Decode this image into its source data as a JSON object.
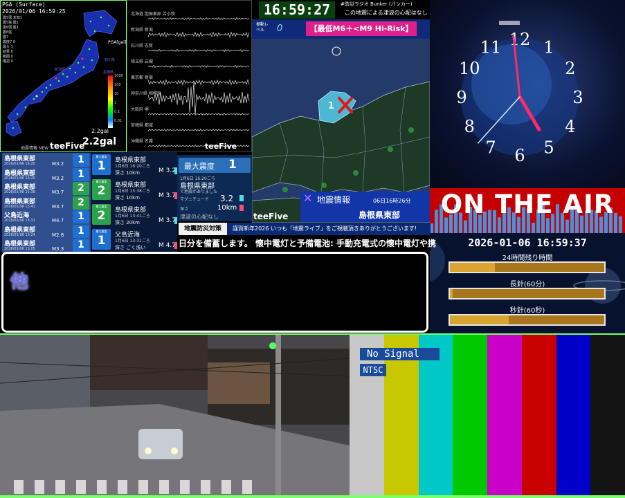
{
  "pga_panel": {
    "title": "PGA (Surface)",
    "timestamp": "2026/01/06 16:59:25",
    "stats": [
      "震5弱  未知1",
      "震5強  震1",
      "震6弱  震1",
      "震6強  ",
      "震7  ",
      "震度7 0",
      "最大 1",
      "結果 8",
      "範囲 0",
      "確認 0"
    ],
    "unit_label": "PGA[gal]",
    "scale_ticks": [
      "1000",
      "100",
      "10",
      "1",
      "0.1",
      "0.01"
    ],
    "small_value": "2.2gal",
    "big_value": "2.2gal",
    "map_labels": [
      "新潟県",
      "石川県",
      "島根県"
    ]
  },
  "waveform_panel": {
    "stations": [
      "北海道 胆振東部 苫小牧",
      "新潟県 新潟",
      "石川県 志賀",
      "埼玉県 岩槻",
      "東京都 新宿",
      "神奈川県 相模原",
      "大阪府 堺",
      "宮崎県 都城",
      "沖縄県 名護"
    ],
    "brand": "teeFive"
  },
  "quake_list": {
    "header": "地震情報 NEW",
    "brand": "teeFive",
    "rows": [
      {
        "name": "島根県東部",
        "date": "2026/01/06 16:20",
        "mag": "M3.2",
        "shindo": "1"
      },
      {
        "name": "島根県東部",
        "date": "2026/01/06 16:20",
        "mag": "M3.2",
        "shindo": "1"
      },
      {
        "name": "島根県東部",
        "date": "2026/01/06 15:38",
        "mag": "M3.7",
        "shindo": "2"
      },
      {
        "name": "島根県東部",
        "date": "2026/01/06 13:41",
        "mag": "M3.7",
        "shindo": "2"
      },
      {
        "name": "父島近海",
        "date": "2026/01/06 13:31",
        "mag": "M4.7",
        "shindo": "1"
      },
      {
        "name": "島根県東部",
        "date": "2026/01/06 13:24",
        "mag": "M2.8",
        "shindo": "1"
      },
      {
        "name": "島根県東部",
        "date": "2026/01/06 13:05",
        "mag": "M3.3",
        "shindo": "1"
      }
    ]
  },
  "quake_detail": [
    {
      "box_label": "最大震度",
      "shindo": "1",
      "place": "島根県東部",
      "time": "1月6日 16:20ごろ",
      "depth": "深さ 10km",
      "mag": "M 3.2"
    },
    {
      "box_label": "最大震度",
      "shindo": "2",
      "place": "島根県東部",
      "time": "1月6日 15:38ごろ",
      "depth": "深さ 10km",
      "mag": "M 3.7"
    },
    {
      "box_label": "最大震度",
      "shindo": "2",
      "place": "島根県東部",
      "time": "1月6日 13:41ごろ",
      "depth": "深さ 20km",
      "mag": "M 3.7"
    },
    {
      "box_label": "最大震度",
      "shindo": "1",
      "place": "父島近海",
      "time": "1月6日 13:31ごろ",
      "depth": "深さ ごく浅い",
      "mag": "M 4.7"
    }
  ],
  "max_intensity": {
    "label": "最大震度",
    "value": "1",
    "time": "1月6日 16:20ごろ",
    "place": "島根県東部",
    "note": "で地震がありました",
    "mag_label": "マグニチュード",
    "mag_value": "3.2",
    "depth_label": "深さ",
    "depth_value": "10km",
    "tsunami": "津波の心配なし"
  },
  "top_bar": {
    "time": "16:59:27",
    "bunker": "#防災ラジオ Bunker (バンカー)",
    "tsunami_note": "この地震による津波の心配はなし",
    "level_label": "振動レベル",
    "level_value": "0",
    "risk": "【最低M6＋<M9 Hi-Risk】"
  },
  "map_panel": {
    "epicenter_shindo": "1",
    "info_label": "地震情報",
    "info_time": "06日16時26分",
    "info_place": "島根県東部",
    "brand": "teeFive"
  },
  "clock": {
    "numbers": [
      "12",
      "1",
      "2",
      "3",
      "4",
      "5",
      "6",
      "7",
      "8",
      "9",
      "10",
      "11"
    ],
    "hour": 4,
    "minute": 59,
    "second": 37
  },
  "on_air": {
    "label": "ON THE AIR"
  },
  "status": {
    "datetime": "2026-01-06 16:59:37",
    "bars": [
      {
        "label": "24時間残り時間",
        "fraction": 0.29
      },
      {
        "label": "長針(60分)",
        "fraction": 0.02
      },
      {
        "label": "秒針(60秒)",
        "fraction": 0.38
      }
    ]
  },
  "ticker": {
    "tag": "地震防災対策",
    "line1": "謹賀新年2026  いつも「地震ライブ」をご視聴頂きありがとうございます!",
    "line2": "日分を備蓄します。  懐中電灯と予備電池: 手動充電式の懐中電灯や携"
  },
  "message": {
    "text": "他"
  },
  "test_pattern": {
    "no_signal": "No Signal",
    "standard": "NTSC",
    "colors": [
      "#c8c8c8",
      "#c8c800",
      "#00c8c8",
      "#00c800",
      "#c800c8",
      "#c80000",
      "#0000c8",
      "#141414"
    ]
  },
  "accent_color": "#7aff6a"
}
